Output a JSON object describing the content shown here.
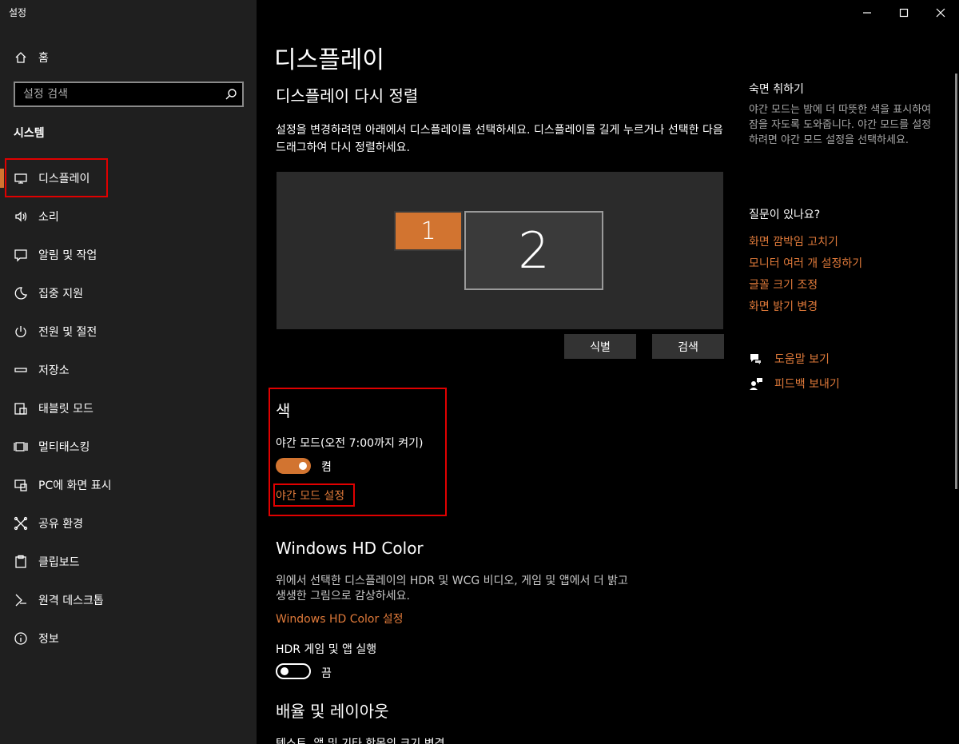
{
  "app": {
    "title": "설정"
  },
  "nav": {
    "home": "홈",
    "search_placeholder": "설정 검색",
    "section": "시스템",
    "items": [
      {
        "label": "디스플레이",
        "icon": "monitor-icon"
      },
      {
        "label": "소리",
        "icon": "speaker-icon"
      },
      {
        "label": "알림 및 작업",
        "icon": "message-icon"
      },
      {
        "label": "집중 지원",
        "icon": "moon-icon"
      },
      {
        "label": "전원 및 절전",
        "icon": "power-icon"
      },
      {
        "label": "저장소",
        "icon": "storage-icon"
      },
      {
        "label": "태블릿 모드",
        "icon": "tablet-icon"
      },
      {
        "label": "멀티태스킹",
        "icon": "multitask-icon"
      },
      {
        "label": "PC에 화면 표시",
        "icon": "project-icon"
      },
      {
        "label": "공유 환경",
        "icon": "share-icon"
      },
      {
        "label": "클립보드",
        "icon": "clipboard-icon"
      },
      {
        "label": "원격 데스크톱",
        "icon": "remote-icon"
      },
      {
        "label": "정보",
        "icon": "info-icon"
      }
    ]
  },
  "main": {
    "title": "디스플레이",
    "arrange_title": "디스플레이 다시 정렬",
    "arrange_desc": "설정을 변경하려면 아래에서 디스플레이를 선택하세요. 디스플레이를 길게 누르거나 선택한 다음 드래그하여 다시 정렬하세요.",
    "monitor1": "1",
    "monitor2": "2",
    "identify_btn": "식별",
    "detect_btn": "검색",
    "color": {
      "title": "색",
      "night_label": "야간 모드(오전 7:00까지 켜기)",
      "night_state": "켬",
      "night_on": true,
      "night_link": "야간 모드 설정"
    },
    "hd": {
      "title": "Windows HD Color",
      "desc": "위에서 선택한 디스플레이의 HDR 및 WCG 비디오, 게임 및 앱에서 더 밝고 생생한 그림으로 감상하세요.",
      "link": "Windows HD Color 설정",
      "hdr_label": "HDR 게임 및 앱 실행",
      "hdr_state": "끔",
      "hdr_on": false
    },
    "layout_title": "배율 및 레이아웃",
    "cutoff_text": "텍스트, 앱 및 기타 항목의 크기 변경"
  },
  "side": {
    "sleep_title": "숙면 취하기",
    "sleep_desc": "야간 모드는 밤에 더 따뜻한 색을 표시하여 잠을 자도록 도와줍니다. 야간 모드를 설정하려면 야간 모드 설정을 선택하세요.",
    "question_title": "질문이 있나요?",
    "links": [
      "화면 깜박임 고치기",
      "모니터 여러 개 설정하기",
      "글꼴 크기 조정",
      "화면 밝기 변경"
    ],
    "help": "도움말 보기",
    "feedback": "피드백 보내기"
  },
  "colors": {
    "accent": "#d27430",
    "link": "#e07a3a",
    "highlight": "#e00000"
  }
}
